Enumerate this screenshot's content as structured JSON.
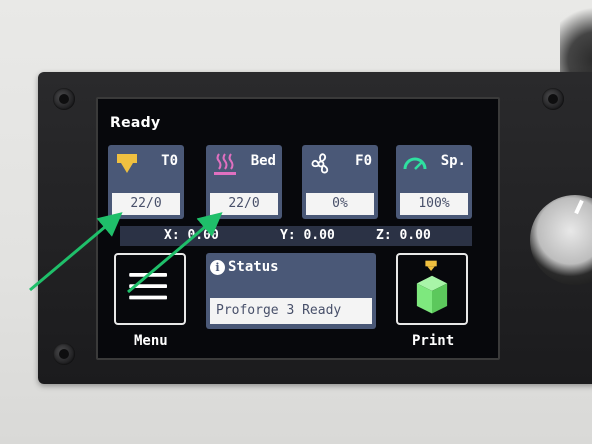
{
  "screen": {
    "title": "Ready"
  },
  "tiles": [
    {
      "label": "T0",
      "value": "22/0",
      "icon": "hotend-icon"
    },
    {
      "label": "Bed",
      "value": "22/0",
      "icon": "heated-bed-icon"
    },
    {
      "label": "F0",
      "value": "0%",
      "icon": "fan-icon"
    },
    {
      "label": "Sp.",
      "value": "100%",
      "icon": "speed-gauge-icon"
    }
  ],
  "coords": {
    "x": "X: 0.00",
    "y": "Y: 0.00",
    "z": "Z: 0.00"
  },
  "menu_button": {
    "label": "Menu",
    "icon": "hamburger-menu-icon"
  },
  "status": {
    "title": "Status",
    "message": "Proforge 3 Ready",
    "icon": "info-icon"
  },
  "print_button": {
    "label": "Print",
    "icon": "print-cube-icon"
  },
  "colors": {
    "tile_bg": "#4a5877",
    "screen_bg": "#07080c",
    "hotend": "#f0c040",
    "bed": "#e070c0",
    "cube": "#7ee87e",
    "annotation_arrow": "#1fbf6a"
  }
}
